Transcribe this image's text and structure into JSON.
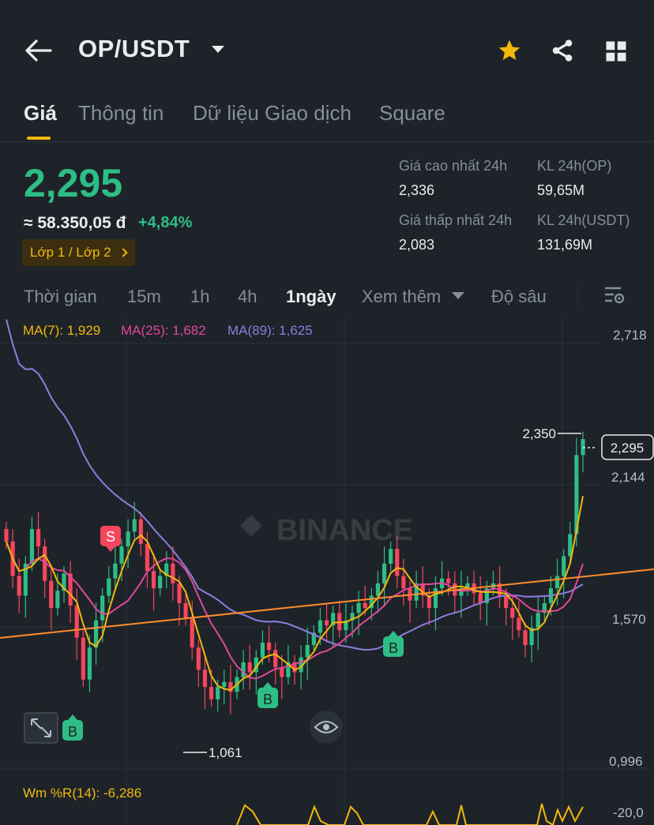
{
  "header": {
    "pair": "OP/USDT"
  },
  "tabs": [
    "Giá",
    "Thông tin",
    "Dữ liệu Giao dịch",
    "Square"
  ],
  "price": {
    "last": "2,295",
    "fiat": "≈ 58.350,05 đ",
    "change": "+4,84%",
    "layer_label": "Lớp 1 / Lớp 2"
  },
  "stats": {
    "high_label": "Giá cao nhất 24h",
    "high": "2,336",
    "vol_op_label": "KL 24h(OP)",
    "vol_op": "59,65M",
    "low_label": "Giá thấp nhất 24h",
    "low": "2,083",
    "vol_usdt_label": "KL 24h(USDT)",
    "vol_usdt": "131,69M"
  },
  "intervals": {
    "time": "Thời gian",
    "m15": "15m",
    "h1": "1h",
    "h4": "4h",
    "d1": "1ngày",
    "more": "Xem thêm",
    "depth": "Độ sâu"
  },
  "indicators": {
    "ma7": "MA(7): 1,929",
    "ma25": "MA(25): 1,682",
    "ma89": "MA(89): 1,625",
    "wmr": "Wm %R(14): -6,286"
  },
  "chart": {
    "axis": [
      "2,718",
      "2,144",
      "1,570",
      "0,996"
    ],
    "wmr_axis": "-20,0",
    "high_mark": "2,350",
    "low_mark": "1,061",
    "current_price": "2,295",
    "watermark": "BINANCE",
    "sell_marker": "S",
    "buy_marker": "B",
    "colors": {
      "up": "#2ebd85",
      "down": "#f6465d",
      "ma7": "#f0b90b",
      "ma25": "#e0489c",
      "ma89": "#8f7ce0",
      "trend": "#ff8c2e"
    }
  },
  "chart_data": {
    "type": "candlestick",
    "ylim": [
      0.996,
      2.718
    ],
    "close": [
      1.88,
      1.74,
      1.66,
      1.79,
      1.93,
      1.86,
      1.72,
      1.61,
      1.68,
      1.75,
      1.62,
      1.49,
      1.32,
      1.45,
      1.56,
      1.66,
      1.73,
      1.79,
      1.86,
      1.92,
      1.97,
      1.87,
      1.76,
      1.69,
      1.74,
      1.79,
      1.71,
      1.63,
      1.57,
      1.45,
      1.36,
      1.29,
      1.24,
      1.29,
      1.31,
      1.27,
      1.33,
      1.39,
      1.35,
      1.41,
      1.47,
      1.44,
      1.37,
      1.33,
      1.39,
      1.35,
      1.41,
      1.46,
      1.51,
      1.56,
      1.54,
      1.59,
      1.52,
      1.56,
      1.59,
      1.63,
      1.61,
      1.66,
      1.71,
      1.79,
      1.85,
      1.74,
      1.69,
      1.64,
      1.71,
      1.66,
      1.61,
      1.69,
      1.73,
      1.71,
      1.66,
      1.69,
      1.71,
      1.67,
      1.63,
      1.69,
      1.71,
      1.66,
      1.61,
      1.57,
      1.52,
      1.46,
      1.53,
      1.59,
      1.63,
      1.69,
      1.74,
      1.82,
      1.91,
      2.23,
      2.295
    ],
    "ma7_last": 1.929,
    "ma25_last": 1.682,
    "ma89_last": 1.625
  }
}
